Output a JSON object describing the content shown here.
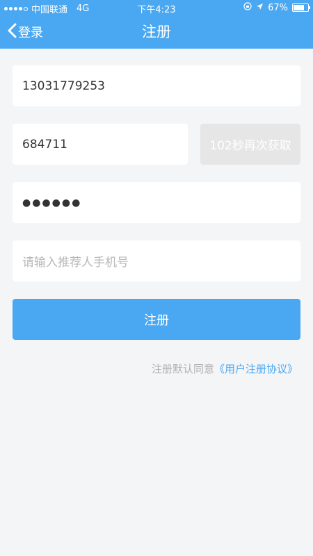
{
  "status_bar": {
    "carrier": "中国联通",
    "network": "4G",
    "time": "下午4:23",
    "battery": "67%",
    "battery_level": 0.67
  },
  "nav": {
    "back_label": "登录",
    "title": "注册"
  },
  "form": {
    "phone_value": "13031779253",
    "code_value": "684711",
    "code_button_label": "102秒再次获取",
    "password_masked": "●●●●●●",
    "referrer_placeholder": "请输入推荐人手机号",
    "submit_label": "注册"
  },
  "agreement": {
    "prefix": "注册默认同意",
    "link": "《用户注册协议》"
  },
  "colors": {
    "primary": "#4aa8f2",
    "background": "#f4f5f7",
    "disabled": "#e6e6e6"
  }
}
